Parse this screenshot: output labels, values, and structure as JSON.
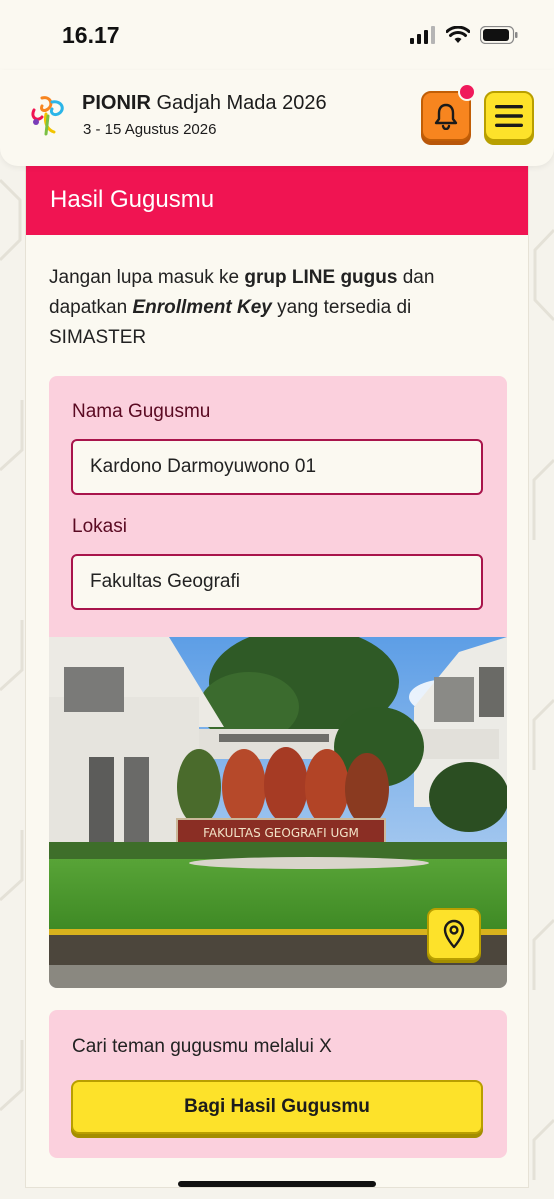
{
  "status_bar": {
    "time": "16.17"
  },
  "header": {
    "brand_bold": "PIONIR",
    "brand_rest": " Gadjah Mada 2026",
    "date": "3 - 15 Agustus 2026"
  },
  "card": {
    "title": "Hasil Gugusmu",
    "intro": {
      "part1": "Jangan lupa masuk ke ",
      "bold1": "grup LINE gugus",
      "part2": " dan dapatkan ",
      "italic1": "Enrollment Key",
      "part3": " yang tersedia di SIMASTER"
    },
    "group_label": "Nama Gugusmu",
    "group_value": "Kardono Darmoyuwono 01",
    "location_label": "Lokasi",
    "location_value": "Fakultas Geografi",
    "photo_sign": "FAKULTAS GEOGRAFI UGM",
    "share_text": "Cari teman gugusmu melalui X",
    "share_button": "Bagi Hasil Gugusmu"
  },
  "colors": {
    "accent_red": "#f01452",
    "accent_pink": "#fbd0dd",
    "accent_yellow": "#fde22a",
    "accent_orange": "#f7851f"
  },
  "icons": [
    "signal-icon",
    "wifi-icon",
    "battery-icon",
    "bell-icon",
    "hamburger-menu-icon",
    "map-pin-icon"
  ]
}
